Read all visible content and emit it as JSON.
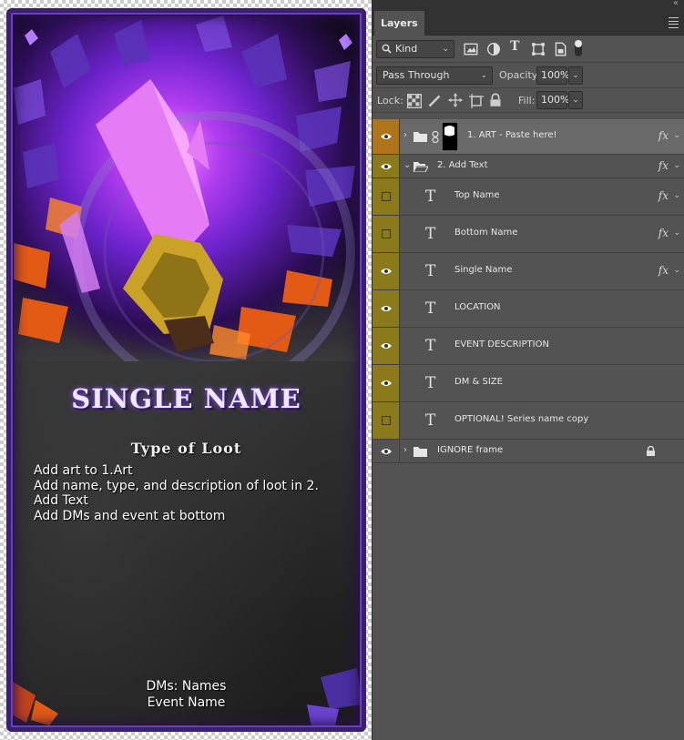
{
  "card": {
    "title": "SINGLE NAME",
    "loot_type": "Type of Loot",
    "instructions": [
      "Add art to 1.Art",
      "Add name, type, and description of loot in 2.",
      "Add Text",
      "Add DMs and event at bottom"
    ],
    "dm_line": "DMs: Names",
    "event_line": "Event Name"
  },
  "panel": {
    "tab_label": "Layers",
    "filter": {
      "kind_label": "Kind"
    },
    "blend_mode": "Pass Through",
    "opacity_label": "Opacity:",
    "opacity_value": "100%",
    "lock_label": "Lock:",
    "fill_label": "Fill:",
    "fill_value": "100%"
  },
  "layers": [
    {
      "name": "1. ART - Paste here!",
      "type": "group-with-mask",
      "visible": true,
      "fx": true,
      "selected": true
    },
    {
      "name": "2. Add Text",
      "type": "group-open",
      "visible": true,
      "fx": true
    },
    {
      "name": "Top Name",
      "type": "text",
      "visible": false,
      "fx": true
    },
    {
      "name": "Bottom Name",
      "type": "text",
      "visible": false,
      "fx": true
    },
    {
      "name": "Single Name",
      "type": "text",
      "visible": true,
      "fx": true
    },
    {
      "name": "LOCATION",
      "type": "text",
      "visible": true,
      "fx": false
    },
    {
      "name": "EVENT DESCRIPTION",
      "type": "text",
      "visible": true,
      "fx": false
    },
    {
      "name": "DM & SIZE",
      "type": "text",
      "visible": true,
      "fx": false
    },
    {
      "name": "OPTIONAL! Series name copy",
      "type": "text",
      "visible": false,
      "fx": false
    },
    {
      "name": "IGNORE frame",
      "type": "group-locked",
      "visible": true,
      "fx": false
    }
  ],
  "icons": {
    "fx": "fx",
    "text_layer": "T"
  },
  "colors": {
    "visibility_column": "#8b7a1c",
    "selected_visibility": "#b0741b",
    "card_frame": "#3b1f72",
    "title_glow": "#8a4dff"
  }
}
